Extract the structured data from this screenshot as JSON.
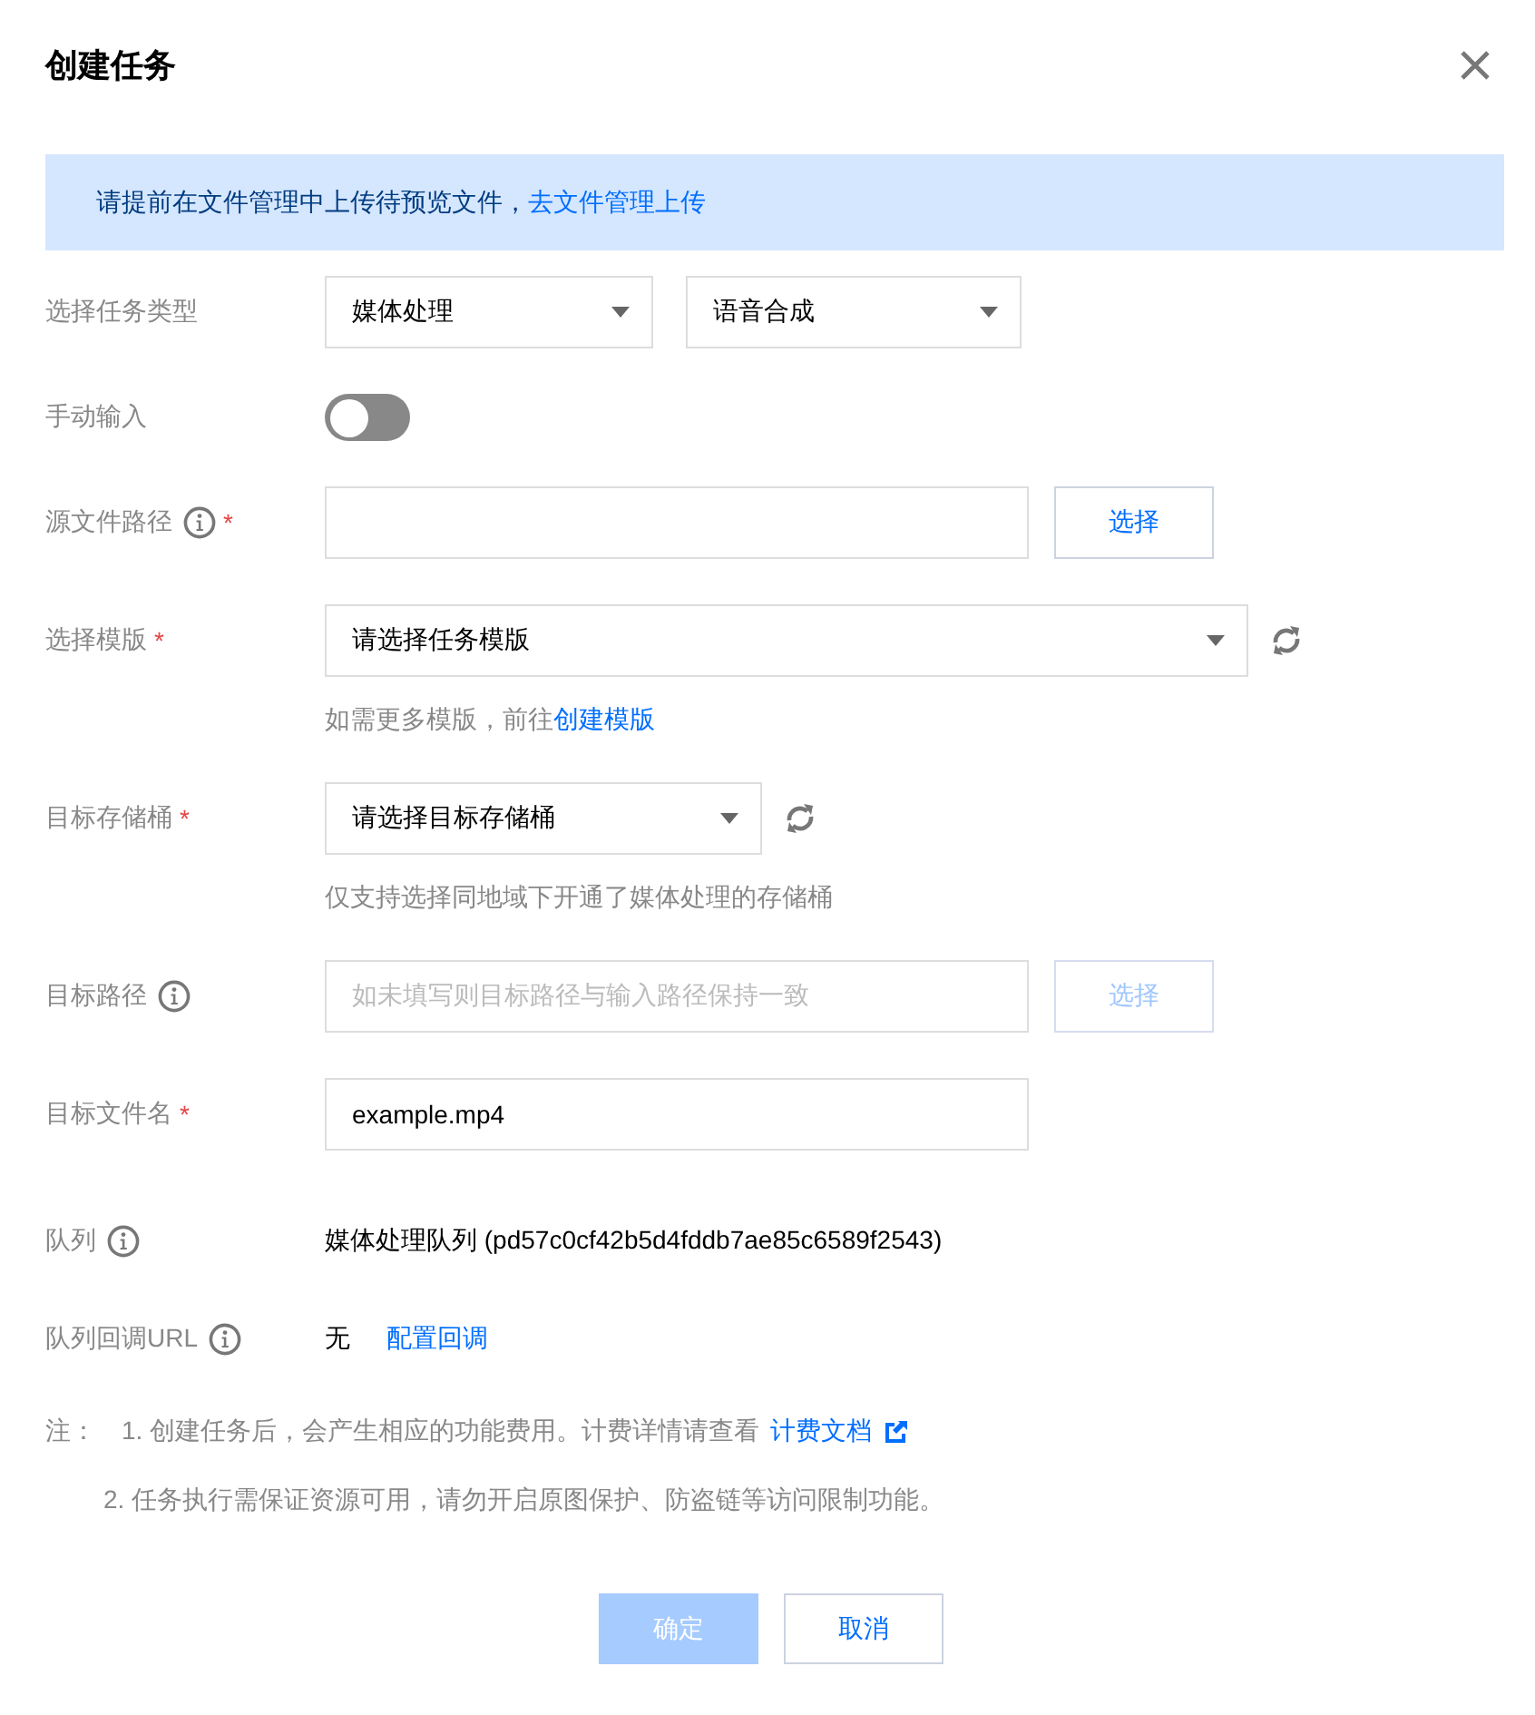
{
  "dialog": {
    "title": "创建任务"
  },
  "notice": {
    "text": "请提前在文件管理中上传待预览文件，",
    "link": "去文件管理上传"
  },
  "fields": [
    {
      "kind": "selects",
      "label": "选择任务类型",
      "info": false,
      "selects": [
        {
          "value": "媒体处理"
        },
        {
          "value": "语音合成"
        }
      ]
    },
    {
      "kind": "toggle",
      "label": "手动输入",
      "info": false,
      "on": false
    },
    {
      "kind": "input_button",
      "label": "源文件路径",
      "required_mark": "*",
      "info": true,
      "button": {
        "label": "选择",
        "disabled": false
      }
    },
    {
      "kind": "select_refresh",
      "label": "选择模版",
      "required_mark": "*",
      "info": false,
      "wide": true,
      "value": "请选择任务模版",
      "hint": {
        "text": "如需更多模版，前往",
        "link": "创建模版"
      }
    },
    {
      "kind": "select_refresh",
      "label": "目标存储桶",
      "required_mark": "*",
      "info": false,
      "wide": false,
      "value": "请选择目标存储桶",
      "hint": {
        "text": "仅支持选择同地域下开通了媒体处理的存储桶"
      }
    },
    {
      "kind": "input_button",
      "label": "目标路径",
      "info": true,
      "placeholder": "如未填写则目标路径与输入路径保持一致",
      "button": {
        "label": "选择",
        "disabled": true
      }
    },
    {
      "kind": "input",
      "label": "目标文件名",
      "required_mark": "*",
      "info": false,
      "value": "example.mp4"
    },
    {
      "kind": "text",
      "label": "队列",
      "info": true,
      "value": "媒体处理队列 (pd57c0cf42b5d4fddb7ae85c6589f2543)"
    },
    {
      "kind": "text",
      "label": "队列回调URL",
      "info": true,
      "value": "无",
      "link": "配置回调"
    }
  ],
  "notes": {
    "label": "注：",
    "items": [
      {
        "text": "1. 创建任务后，会产生相应的功能费用。计费详情请查看",
        "link": "计费文档"
      },
      {
        "text": "2. 任务执行需保证资源可用，请勿开启原图保护、防盗链等访问限制功能。"
      }
    ]
  },
  "buttons": [
    {
      "label": "确定",
      "kind": "primary",
      "disabled": true
    },
    {
      "label": "取消",
      "kind": "secondary",
      "disabled": false
    }
  ]
}
